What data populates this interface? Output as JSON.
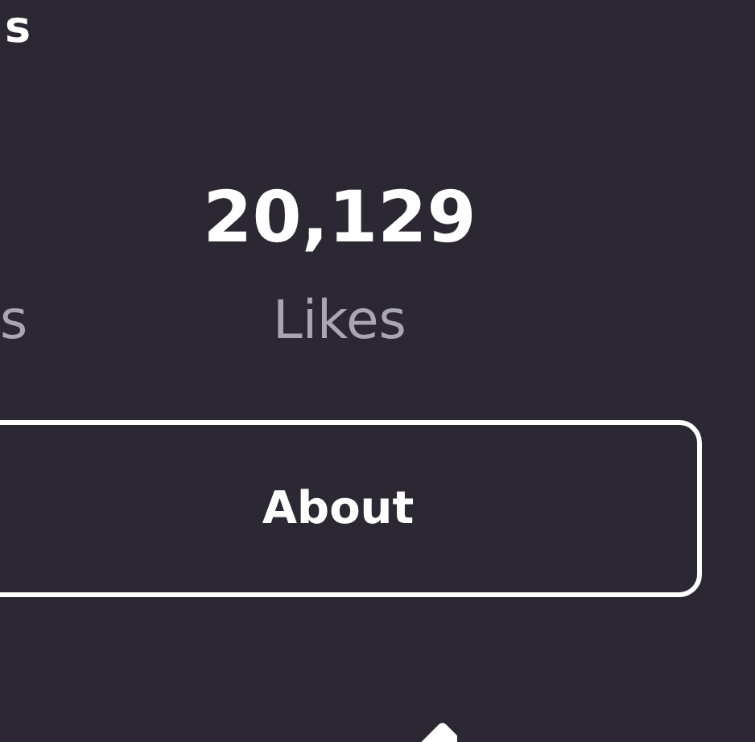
{
  "header": {
    "title": "s"
  },
  "stats": [
    {
      "label": "s"
    },
    {
      "value": "20,129",
      "label": "Likes"
    }
  ],
  "about_button": {
    "label": "About"
  }
}
